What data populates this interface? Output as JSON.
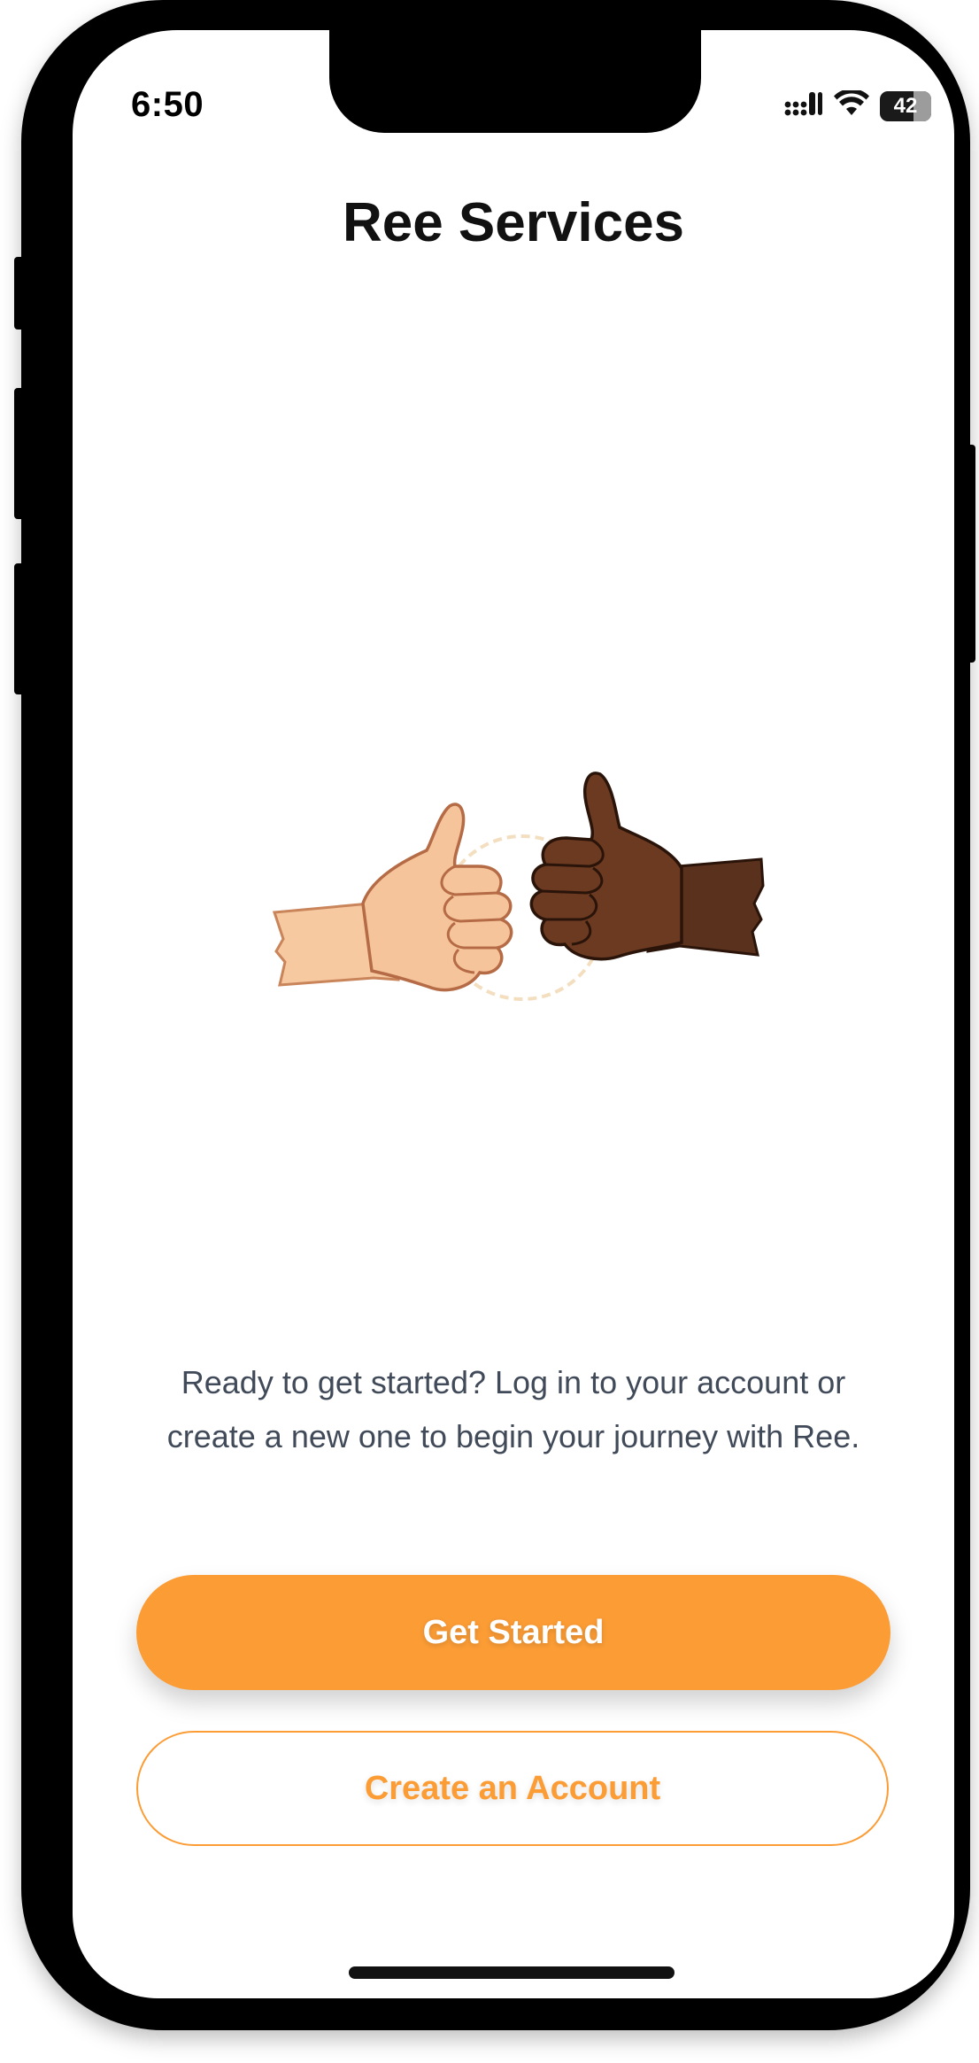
{
  "status_bar": {
    "time": "6:50",
    "battery_level": "42",
    "signal_icon": "cellular-signal-icon",
    "wifi_icon": "wifi-icon",
    "battery_icon": "battery-icon"
  },
  "header": {
    "title": "Ree Services"
  },
  "hero": {
    "illustration": "thumbs-up-hands-illustration"
  },
  "main": {
    "description": "Ready to get started? Log in to your account or create a new one to begin your journey with Ree."
  },
  "actions": {
    "primary_label": "Get Started",
    "secondary_label": "Create an Account"
  },
  "colors": {
    "accent": "#fb9c35",
    "text_primary": "#111111",
    "text_secondary": "#414a59",
    "background": "#ffffff"
  }
}
